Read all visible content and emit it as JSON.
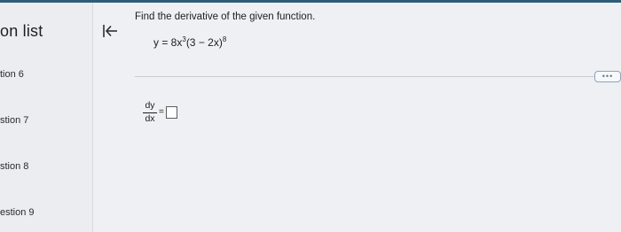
{
  "sidebar": {
    "title": "on list",
    "items": [
      {
        "label": "tion 6"
      },
      {
        "label": "stion 7"
      },
      {
        "label": "stion 8"
      },
      {
        "label": "estion 9"
      }
    ]
  },
  "toolbar": {
    "collapse_icon": "collapse-left-icon"
  },
  "question": {
    "prompt": "Find the derivative of the given function.",
    "equation": {
      "lhs": "y = 8x",
      "exp1": "3",
      "mid": "(3 − 2x)",
      "exp2": "8"
    },
    "more_label": "•••",
    "answer": {
      "numerator": "dy",
      "denominator": "dx",
      "equals": "=",
      "value": ""
    }
  },
  "colors": {
    "topbar": "#2e5d78",
    "background": "#eef0f4",
    "more_border": "#8fa3b8"
  }
}
